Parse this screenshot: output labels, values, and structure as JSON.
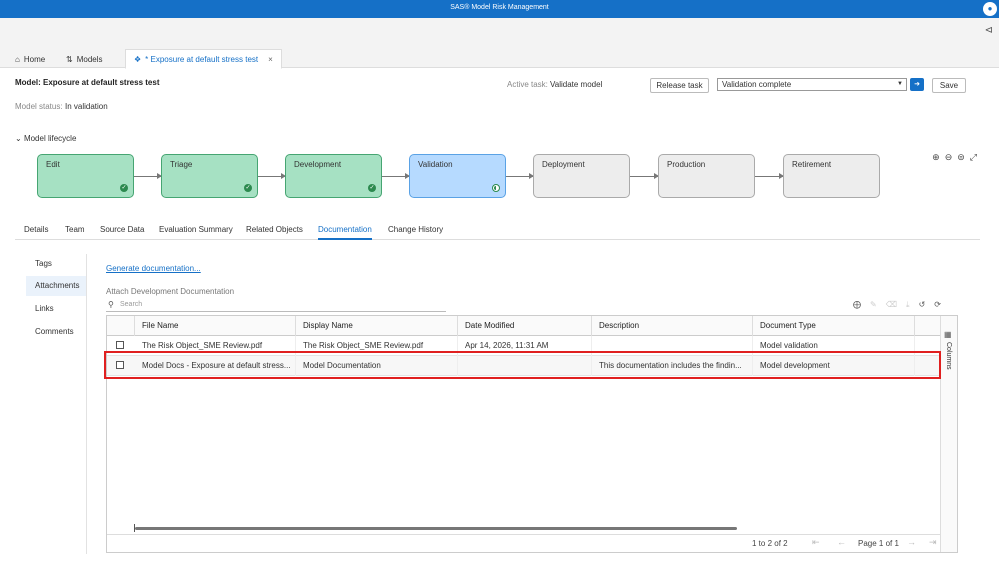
{
  "app": {
    "title": "SAS® Model Risk Management",
    "user_icon": "user-icon"
  },
  "nav_tabs": [
    {
      "label": "Home",
      "icon": "home-icon"
    },
    {
      "label": "Models",
      "icon": "models-icon"
    },
    {
      "label": "* Exposure at default stress test",
      "icon": "model-node-icon",
      "close": "×"
    }
  ],
  "header": {
    "title": "Model: Exposure at default stress test",
    "active_task_label": "Active task:",
    "active_task_value": "Validate model",
    "release_button": "Release task",
    "status_select_value": "Validation complete",
    "save_button": "Save",
    "model_status_label": "Model status:",
    "model_status_value": "In validation"
  },
  "lifecycle": {
    "toggle_label": "Model lifecycle",
    "stages": [
      {
        "label": "Edit",
        "state": "done"
      },
      {
        "label": "Triage",
        "state": "done"
      },
      {
        "label": "Development",
        "state": "done"
      },
      {
        "label": "Validation",
        "state": "current"
      },
      {
        "label": "Deployment",
        "state": "pending"
      },
      {
        "label": "Production",
        "state": "pending"
      },
      {
        "label": "Retirement",
        "state": "pending"
      }
    ]
  },
  "detail_tabs": [
    "Details",
    "Team",
    "Source Data",
    "Evaluation Summary",
    "Related Objects",
    "Documentation",
    "Change History"
  ],
  "side_items": [
    "Tags",
    "Attachments",
    "Links",
    "Comments"
  ],
  "documentation": {
    "generate_link": "Generate documentation...",
    "attach_label": "Attach Development Documentation",
    "search_placeholder": "Search",
    "columns": [
      "File Name",
      "Display Name",
      "Date Modified",
      "Description",
      "Document Type"
    ],
    "rows": [
      [
        "The Risk Object_SME Review.pdf",
        "The Risk Object_SME Review.pdf",
        "Apr 14, 2026, 11:31 AM",
        "",
        "Model validation"
      ],
      [
        "Model Docs - Exposure at default stress...",
        "Model Documentation",
        "",
        "This documentation includes the findin...",
        "Model development"
      ]
    ],
    "columns_pane_label": "Columns",
    "page_count": "1 to 2 of 2",
    "page_label": "Page 1 of 1"
  },
  "colors": {
    "brand": "#1570c7",
    "done": "#a6e1c3",
    "current": "#b6daff",
    "highlight": "#e02020"
  }
}
